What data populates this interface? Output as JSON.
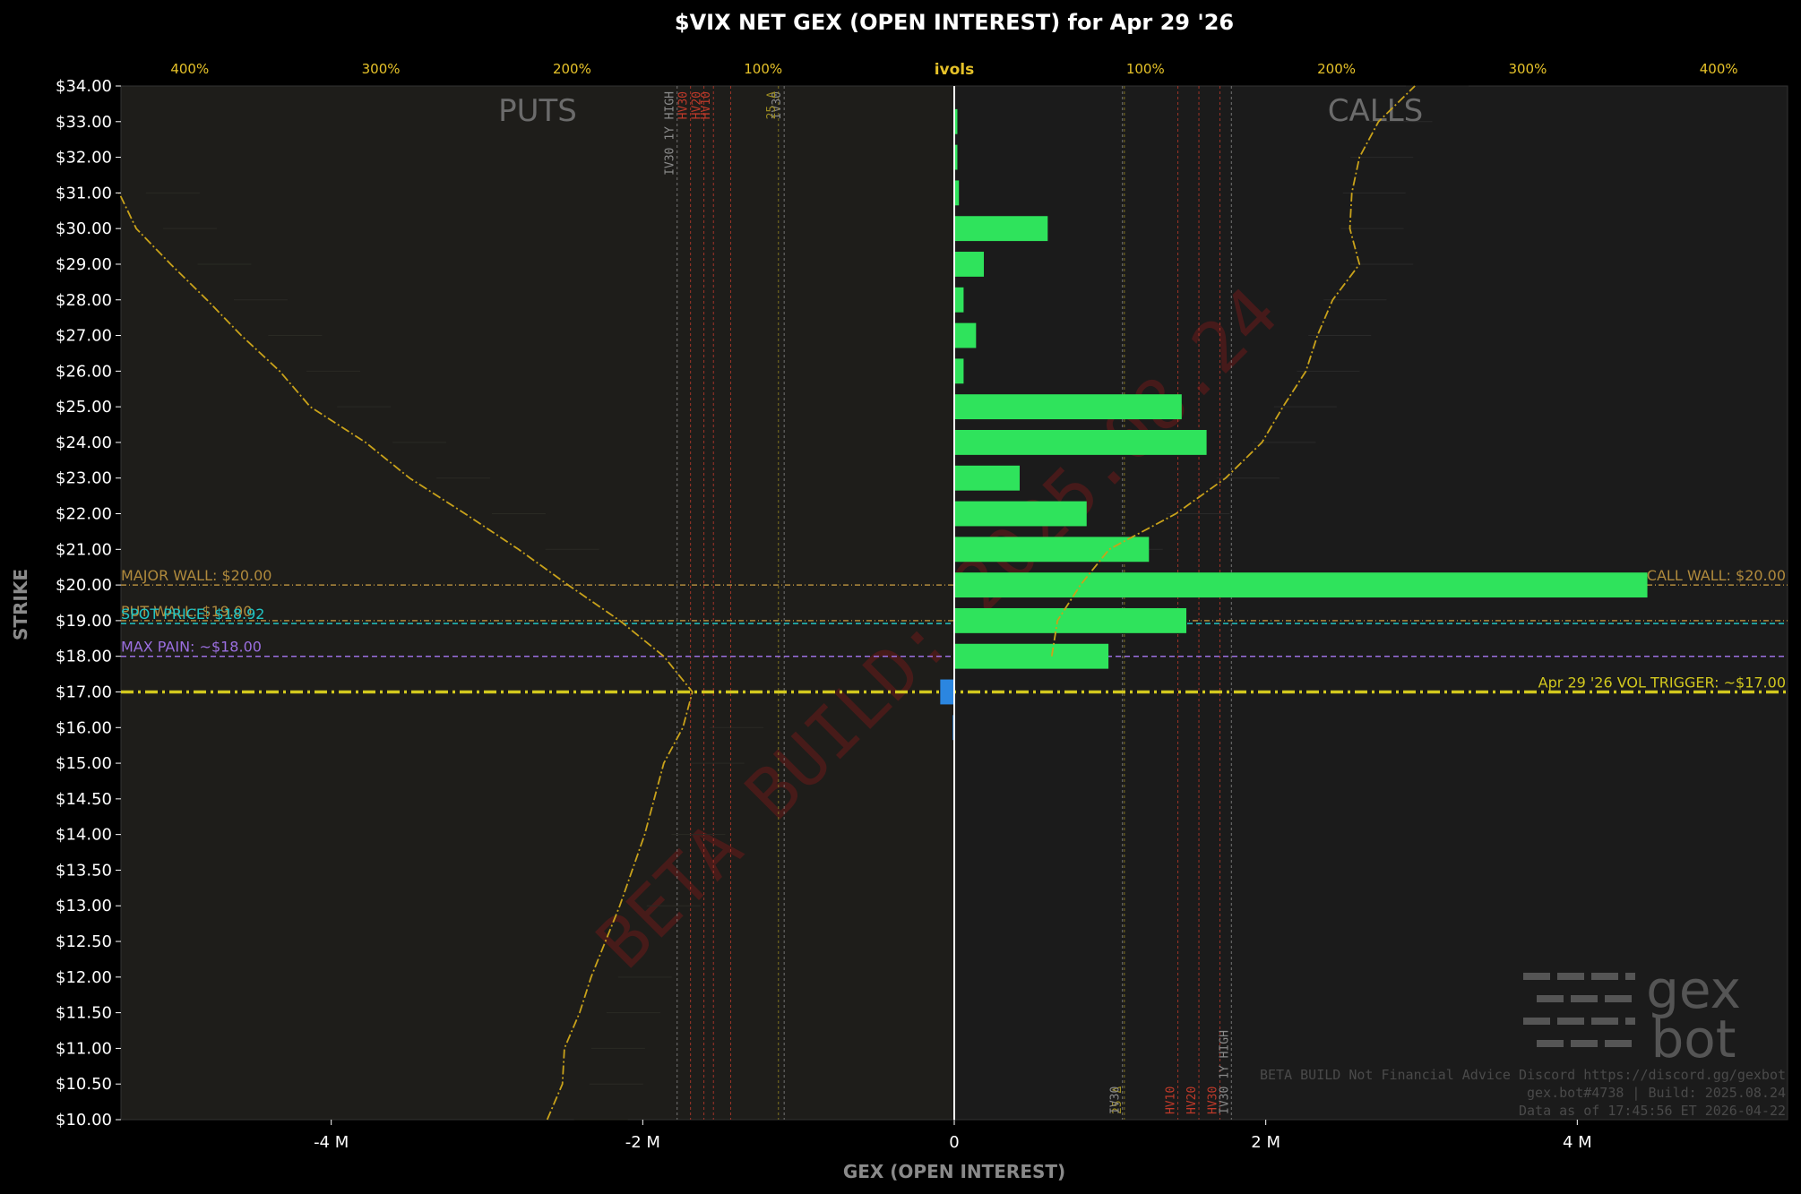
{
  "chart_data": {
    "type": "bar",
    "title": "$VIX NET GEX (OPEN INTEREST) for Apr 29 '26",
    "xlabel": "GEX (OPEN INTEREST)",
    "ylabel": "STRIKE",
    "top_axis_label": "ivols",
    "xlim": [
      -5.35,
      5.35
    ],
    "x_ticks": [
      -4,
      -2,
      0,
      2,
      4
    ],
    "x_tick_labels": [
      "-4 M",
      "-2 M",
      "0",
      "2 M",
      "4 M"
    ],
    "ivol_ticks": [
      {
        "pct": -400,
        "label": "400%"
      },
      {
        "pct": -300,
        "label": "300%"
      },
      {
        "pct": -200,
        "label": "200%"
      },
      {
        "pct": -100,
        "label": "100%"
      },
      {
        "pct": 100,
        "label": "100%"
      },
      {
        "pct": 200,
        "label": "200%"
      },
      {
        "pct": 300,
        "label": "300%"
      },
      {
        "pct": 400,
        "label": "400%"
      }
    ],
    "strike_labels": [
      "$10.00",
      "$10.50",
      "$11.00",
      "$11.50",
      "$12.00",
      "$12.50",
      "$13.00",
      "$13.50",
      "$14.00",
      "$14.50",
      "$15.00",
      "$16.00",
      "$17.00",
      "$18.00",
      "$19.00",
      "$20.00",
      "$21.00",
      "$22.00",
      "$23.00",
      "$24.00",
      "$25.00",
      "$26.00",
      "$27.00",
      "$28.00",
      "$29.00",
      "$30.00",
      "$31.00",
      "$32.00",
      "$33.00",
      "$34.00"
    ],
    "side_labels": {
      "puts": "PUTS",
      "calls": "CALLS"
    },
    "bars": [
      {
        "strike": "$16.00",
        "value": -0.01,
        "color": "#2b86e0"
      },
      {
        "strike": "$17.00",
        "value": -0.09,
        "color": "#2b86e0"
      },
      {
        "strike": "$18.00",
        "value": 0.99,
        "color": "#2fe35c"
      },
      {
        "strike": "$19.00",
        "value": 1.49,
        "color": "#2fe35c"
      },
      {
        "strike": "$20.00",
        "value": 4.45,
        "color": "#2fe35c"
      },
      {
        "strike": "$21.00",
        "value": 1.25,
        "color": "#2fe35c"
      },
      {
        "strike": "$22.00",
        "value": 0.85,
        "color": "#2fe35c"
      },
      {
        "strike": "$23.00",
        "value": 0.42,
        "color": "#2fe35c"
      },
      {
        "strike": "$24.00",
        "value": 1.62,
        "color": "#2fe35c"
      },
      {
        "strike": "$25.00",
        "value": 1.46,
        "color": "#2fe35c"
      },
      {
        "strike": "$26.00",
        "value": 0.06,
        "color": "#2fe35c"
      },
      {
        "strike": "$27.00",
        "value": 0.14,
        "color": "#2fe35c"
      },
      {
        "strike": "$28.00",
        "value": 0.06,
        "color": "#2fe35c"
      },
      {
        "strike": "$29.00",
        "value": 0.19,
        "color": "#2fe35c"
      },
      {
        "strike": "$30.00",
        "value": 0.6,
        "color": "#2fe35c"
      },
      {
        "strike": "$31.00",
        "value": 0.03,
        "color": "#2fe35c"
      },
      {
        "strike": "$32.00",
        "value": 0.02,
        "color": "#2fe35c"
      },
      {
        "strike": "$33.00",
        "value": 0.02,
        "color": "#2fe35c"
      }
    ],
    "horizontal_lines": [
      {
        "strike": "$20.00",
        "left_label": "MAJOR WALL: $20.00",
        "right_label": "CALL WALL: $20.00",
        "color": "#b08a3c",
        "style": "dashdot"
      },
      {
        "strike": "$19.00",
        "left_label": "PUT WALL: $19.00",
        "right_label": "",
        "color": "#b08a3c",
        "style": "dashdot"
      },
      {
        "strike": "$18.92",
        "left_label": "SPOT PRICE: $18.92",
        "right_label": "",
        "color": "#20c4c4",
        "style": "dashed"
      },
      {
        "strike": "$18.00",
        "left_label": "MAX PAIN: ~$18.00",
        "right_label": "",
        "color": "#9b6fe0",
        "style": "dashed"
      },
      {
        "strike": "$17.00",
        "left_label": "",
        "right_label": "Apr 29 '26 VOL TRIGGER: ~$17.00",
        "color": "#d2c81e",
        "style": "thick-dashdot"
      }
    ],
    "ivol_vlines": [
      {
        "pct": -145,
        "label": "IV30 1Y HIGH",
        "color": "#8a8a8a"
      },
      {
        "pct": -138,
        "label": "HV30",
        "color": "#c03a2a"
      },
      {
        "pct": -131,
        "label": "HV20",
        "color": "#c03a2a"
      },
      {
        "pct": -126,
        "label": "HV10",
        "color": "#c03a2a"
      },
      {
        "pct": -117,
        "label": "",
        "color": "#c03a2a"
      },
      {
        "pct": -89,
        "label": "IV30",
        "color": "#8a8a8a"
      },
      {
        "pct": -92,
        "label": "25 Δ",
        "color": "#9a8a20"
      },
      {
        "pct": 89,
        "label": "25 Δ",
        "color": "#9a8a20"
      },
      {
        "pct": 88,
        "label": "IV30",
        "color": "#8a8a8a"
      },
      {
        "pct": 117,
        "label": "HV10",
        "color": "#c03a2a"
      },
      {
        "pct": 128,
        "label": "HV20",
        "color": "#c03a2a"
      },
      {
        "pct": 139,
        "label": "HV30",
        "color": "#c03a2a"
      },
      {
        "pct": 145,
        "label": "IV30 1Y HIGH",
        "color": "#8a8a8a"
      }
    ],
    "put_ivol_curve": [
      {
        "strike": 10,
        "pct": -213
      },
      {
        "strike": 10.5,
        "pct": -205
      },
      {
        "strike": 11,
        "pct": -204
      },
      {
        "strike": 11.5,
        "pct": -196
      },
      {
        "strike": 12,
        "pct": -190
      },
      {
        "strike": 13,
        "pct": -175
      },
      {
        "strike": 14,
        "pct": -162
      },
      {
        "strike": 15,
        "pct": -152
      },
      {
        "strike": 16,
        "pct": -142
      },
      {
        "strike": 17,
        "pct": -137
      },
      {
        "strike": 18,
        "pct": -152
      },
      {
        "strike": 19,
        "pct": -175
      },
      {
        "strike": 20,
        "pct": -202
      },
      {
        "strike": 21,
        "pct": -228
      },
      {
        "strike": 22,
        "pct": -256
      },
      {
        "strike": 23,
        "pct": -285
      },
      {
        "strike": 24,
        "pct": -308
      },
      {
        "strike": 25,
        "pct": -337
      },
      {
        "strike": 26,
        "pct": -353
      },
      {
        "strike": 27,
        "pct": -373
      },
      {
        "strike": 28,
        "pct": -391
      },
      {
        "strike": 29,
        "pct": -410
      },
      {
        "strike": 30,
        "pct": -428
      },
      {
        "strike": 31,
        "pct": -437
      }
    ],
    "call_ivol_curve": [
      {
        "strike": 18,
        "pct": 51
      },
      {
        "strike": 19,
        "pct": 54
      },
      {
        "strike": 20,
        "pct": 66
      },
      {
        "strike": 21,
        "pct": 81
      },
      {
        "strike": 22,
        "pct": 116
      },
      {
        "strike": 23,
        "pct": 142
      },
      {
        "strike": 24,
        "pct": 161
      },
      {
        "strike": 25,
        "pct": 172
      },
      {
        "strike": 26,
        "pct": 184
      },
      {
        "strike": 27,
        "pct": 190
      },
      {
        "strike": 28,
        "pct": 198
      },
      {
        "strike": 29,
        "pct": 212
      },
      {
        "strike": 30,
        "pct": 207
      },
      {
        "strike": 31,
        "pct": 208
      },
      {
        "strike": 32,
        "pct": 212
      },
      {
        "strike": 33,
        "pct": 222
      },
      {
        "strike": 34,
        "pct": 241
      }
    ],
    "watermark": "BETA BUILD: 2025.08.24"
  },
  "logo": {
    "line1": "gex",
    "line2": "bot"
  },
  "footer": [
    "BETA BUILD Not Financial Advice Discord https://discord.gg/gexbot",
    "gex.bot#4738 | Build: 2025.08.24",
    "Data as of 17:45:56 ET 2026-04-22"
  ]
}
